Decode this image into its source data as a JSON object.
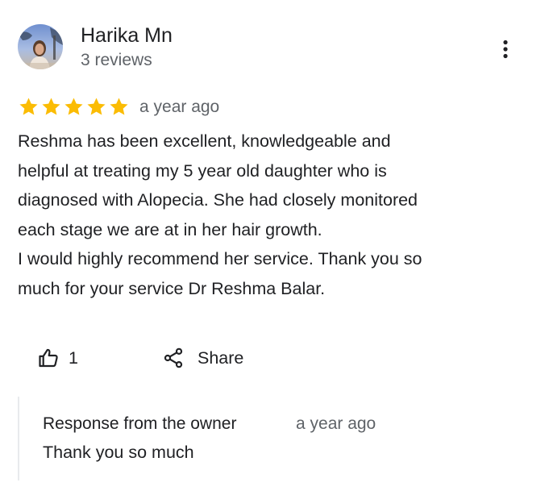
{
  "reviewer": {
    "name": "Harika Mn",
    "review_count": "3 reviews",
    "avatar_icon": "profile-photo"
  },
  "menu": {
    "icon": "more-vert-icon"
  },
  "review": {
    "rating": 5,
    "rating_max": 5,
    "star_color": "#fbbc04",
    "date": "a year ago",
    "lines": [
      "Reshma has been excellent, knowledgeable and",
      "helpful at treating my 5 year old daughter who is",
      "diagnosed with Alopecia. She had closely monitored",
      "each stage we are at in her hair growth.",
      "I would highly recommend her service. Thank you so",
      "much for your service Dr Reshma Balar."
    ]
  },
  "actions": {
    "like_icon": "thumb-up-icon",
    "like_count": "1",
    "share_icon": "share-icon",
    "share_label": "Share"
  },
  "owner_response": {
    "title": "Response from the owner",
    "date": "a year ago",
    "text": "Thank you so much"
  },
  "colors": {
    "primary_text": "#202124",
    "secondary_text": "#5f6368",
    "divider": "#e8eaed"
  }
}
